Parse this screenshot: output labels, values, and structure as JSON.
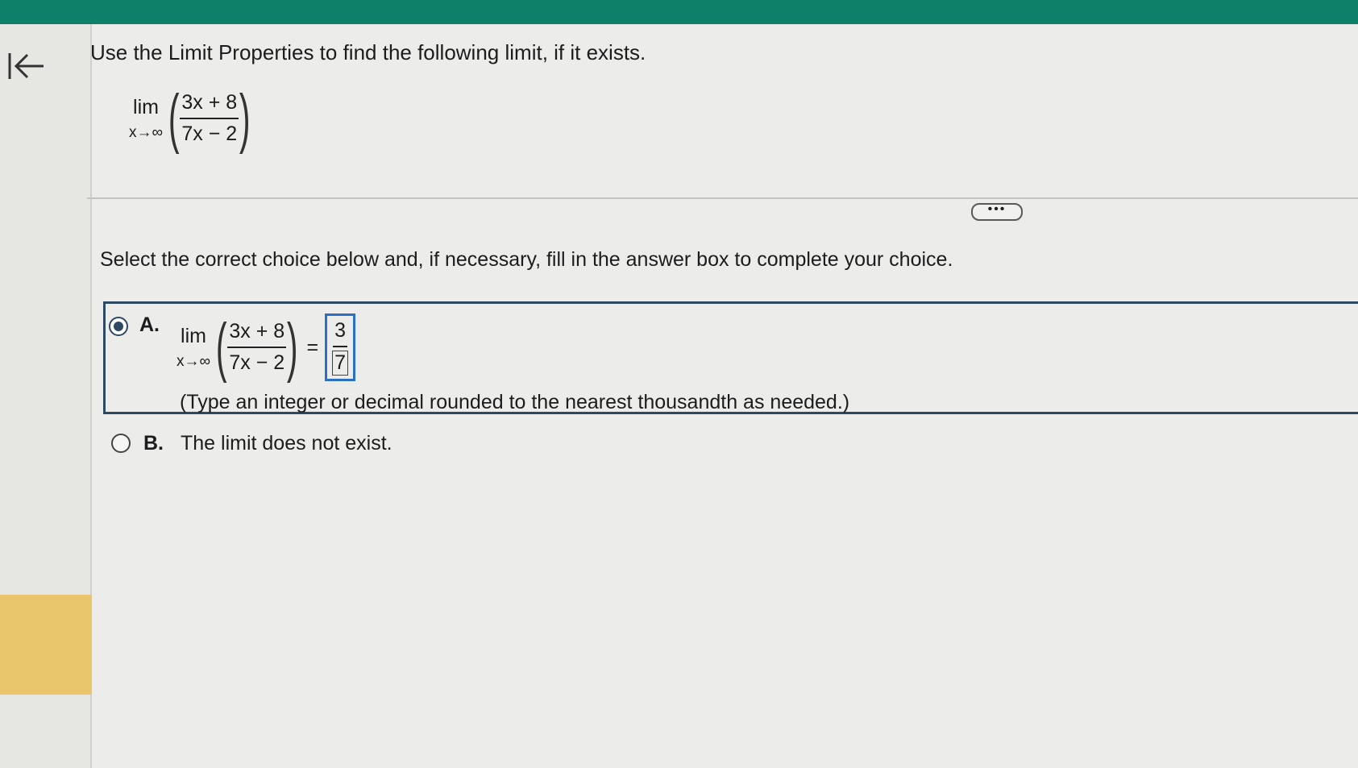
{
  "question": {
    "prompt": "Use the Limit Properties to find the following limit, if it exists.",
    "lim_word": "lim",
    "lim_subscript": "x→∞",
    "numerator": "3x + 8",
    "denominator": "7x − 2"
  },
  "instruction": "Select the correct choice below and, if necessary, fill in the answer box to complete your choice.",
  "choice_a": {
    "letter": "A.",
    "lim_word": "lim",
    "lim_subscript": "x→∞",
    "numerator": "3x + 8",
    "denominator": "7x − 2",
    "equals": "=",
    "answer_numerator": "3",
    "answer_denominator": "7",
    "hint": "(Type an integer or decimal rounded to the nearest thousandth as needed.)"
  },
  "choice_b": {
    "letter": "B.",
    "text": "The limit does not exist."
  },
  "more_button_label": "•••",
  "colors": {
    "top_bar": "#0e7f68",
    "sidebar_tab": "#e9c56b",
    "selected_border": "#2d4963",
    "answer_box_border": "#2a6fc4"
  }
}
